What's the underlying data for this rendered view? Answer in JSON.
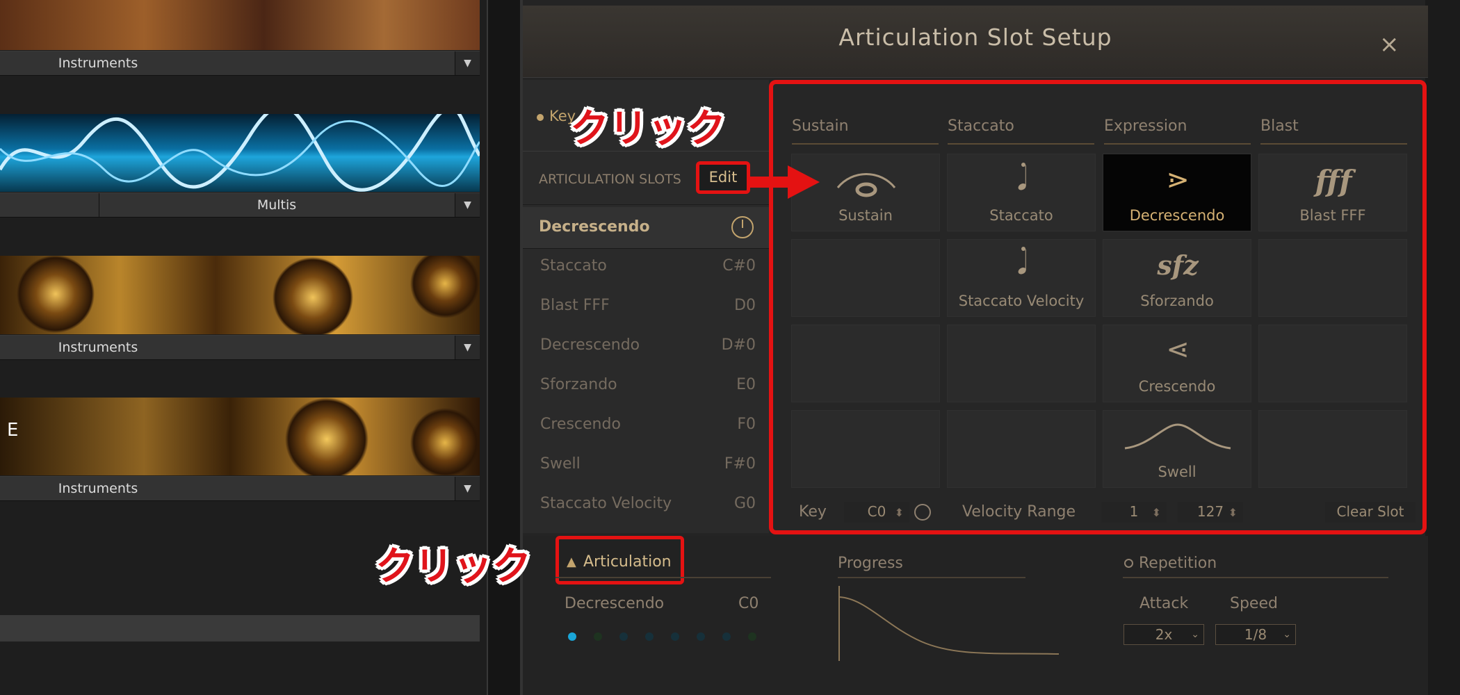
{
  "app": {
    "dialog_title": "Articulation Slot Setup",
    "close_symbol": "×"
  },
  "library_cards": {
    "instruments_1": "Instruments",
    "multis": "Multis",
    "instruments_2": "Instruments",
    "instruments_3": "Instruments",
    "letter_e": "E"
  },
  "panel": {
    "key_tab": "Key",
    "articulation_slots_label": "ARTICULATION SLOTS",
    "edit_button": "Edit",
    "active_slot": "Decrescendo",
    "slots": [
      {
        "name": "Staccato",
        "key": "C#0"
      },
      {
        "name": "Blast FFF",
        "key": "D0"
      },
      {
        "name": "Decrescendo",
        "key": "D#0"
      },
      {
        "name": "Sforzando",
        "key": "E0"
      },
      {
        "name": "Crescendo",
        "key": "F0"
      },
      {
        "name": "Swell",
        "key": "F#0"
      },
      {
        "name": "Staccato Velocity",
        "key": "G0"
      }
    ]
  },
  "grid": {
    "columns": [
      "Sustain",
      "Staccato",
      "Expression",
      "Blast"
    ],
    "cells": {
      "sustain": "Sustain",
      "staccato": "Staccato",
      "decrescendo": "Decrescendo",
      "blast_fff": "Blast FFF",
      "staccato_velocity": "Staccato Velocity",
      "sforzando": "Sforzando",
      "crescendo": "Crescendo",
      "swell": "Swell"
    },
    "glyphs": {
      "fff": "fff",
      "sfz": "sfz",
      "decrescendo": "⋗",
      "crescendo": "⋖"
    },
    "footer": {
      "key_label": "Key",
      "key_value": "C0",
      "velocity_label": "Velocity Range",
      "velocity_min": "1",
      "velocity_max": "127",
      "clear_button": "Clear Slot"
    }
  },
  "bottom": {
    "articulation_label": "Articulation",
    "current_articulation": "Decrescendo",
    "current_key": "C0",
    "progress_label": "Progress",
    "repetition_label": "Repetition",
    "attack_label": "Attack",
    "speed_label": "Speed",
    "attack_value": "2x",
    "speed_value": "1/8"
  },
  "annotations": {
    "click_1": "クリック",
    "click_2": "クリック",
    "arrow": "→"
  },
  "colors": {
    "accent": "#c3a46d",
    "annotation_red": "#e41212",
    "selected_bg": "#050505"
  }
}
